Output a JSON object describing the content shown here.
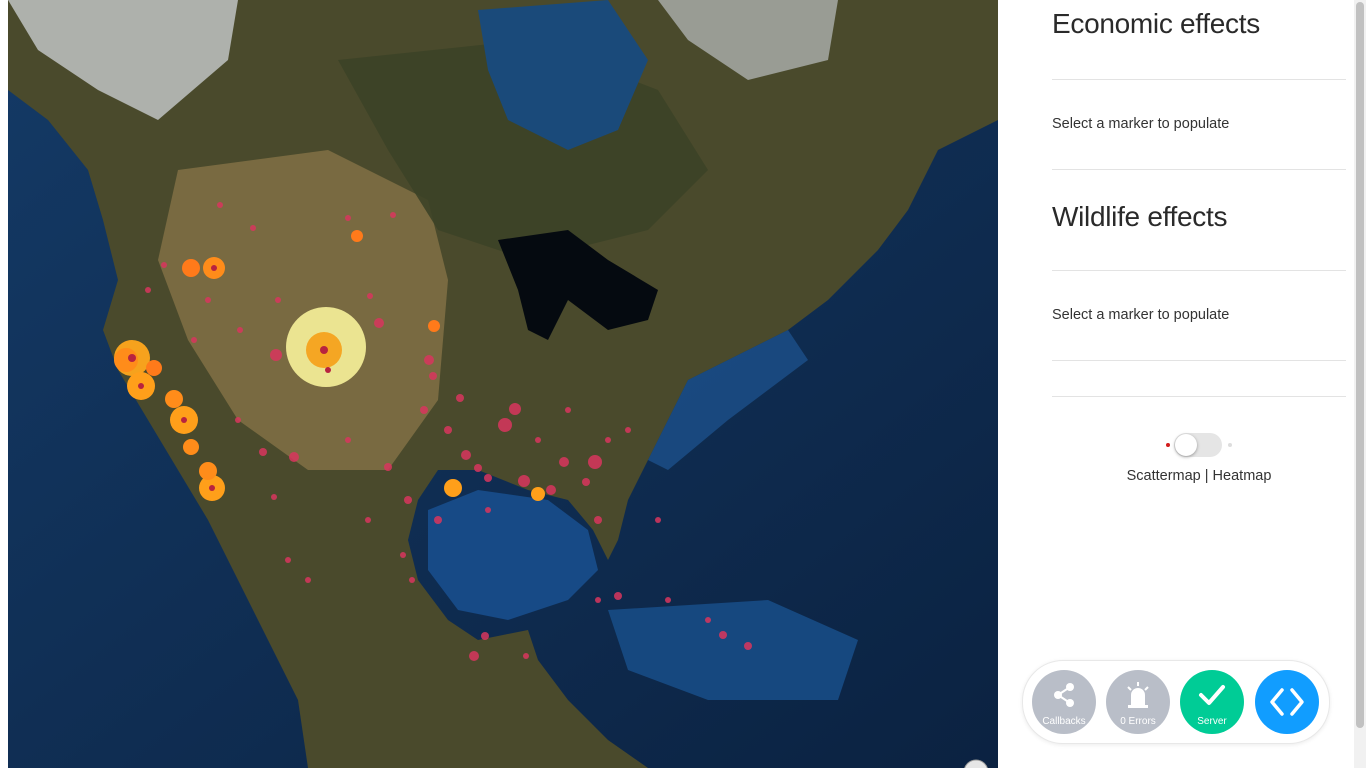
{
  "economic": {
    "title": "Economic effects",
    "placeholder": "Select a marker to populate"
  },
  "wildlife": {
    "title": "Wildlife effects",
    "placeholder": "Select a marker to populate"
  },
  "map_toggle": {
    "label": "Scattermap | Heatmap",
    "state": "Scattermap"
  },
  "devtools": {
    "callbacks_label": "Callbacks",
    "errors_label": "0 Errors",
    "server_label": "Server",
    "icons": [
      "share-icon",
      "alarm-icon",
      "check-icon",
      "code-icon"
    ]
  },
  "colors": {
    "marker_small": "#d9365e",
    "marker_medium": "#ff8c1a",
    "marker_large": "#f7f29a",
    "server_ok": "#00cc96",
    "code_button": "#119dff",
    "inactive_button": "#b9bec8"
  }
}
